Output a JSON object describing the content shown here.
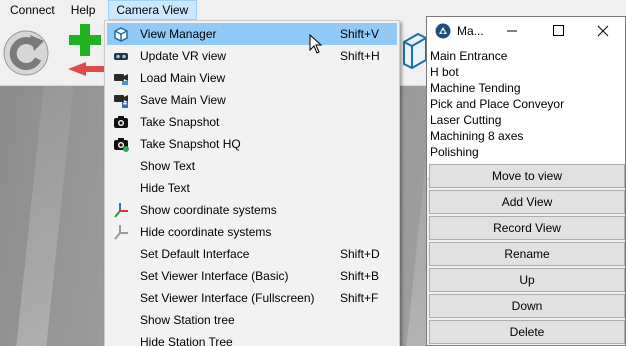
{
  "menubar": {
    "items": [
      {
        "label": "Connect"
      },
      {
        "label": "Help"
      },
      {
        "label": "Camera View"
      }
    ]
  },
  "camera_menu": {
    "items": [
      {
        "label": "View Manager",
        "shortcut": "Shift+V",
        "icon": "cube-outline-icon",
        "highlighted": true
      },
      {
        "label": "Update VR view",
        "shortcut": "Shift+H",
        "icon": "vr-goggles-icon"
      },
      {
        "label": "Load Main View",
        "shortcut": "",
        "icon": "load-camera-icon"
      },
      {
        "label": "Save Main View",
        "shortcut": "",
        "icon": "save-camera-icon"
      },
      {
        "label": "Take Snapshot",
        "shortcut": "",
        "icon": "camera-icon"
      },
      {
        "label": "Take Snapshot HQ",
        "shortcut": "",
        "icon": "camera-hq-icon"
      },
      {
        "label": "Show Text",
        "shortcut": "",
        "icon": ""
      },
      {
        "label": "Hide Text",
        "shortcut": "",
        "icon": ""
      },
      {
        "label": "Show coordinate systems",
        "shortcut": "",
        "icon": "axes-color-icon"
      },
      {
        "label": "Hide coordinate systems",
        "shortcut": "",
        "icon": "axes-gray-icon"
      },
      {
        "label": "Set Default Interface",
        "shortcut": "Shift+D",
        "icon": ""
      },
      {
        "label": "Set Viewer Interface (Basic)",
        "shortcut": "Shift+B",
        "icon": ""
      },
      {
        "label": "Set Viewer Interface (Fullscreen)",
        "shortcut": "Shift+F",
        "icon": ""
      },
      {
        "label": "Show Station tree",
        "shortcut": "",
        "icon": ""
      },
      {
        "label": "Hide Station Tree",
        "shortcut": "",
        "icon": ""
      }
    ]
  },
  "view_manager": {
    "title": "Ma...",
    "views": [
      "Main Entrance",
      "H bot",
      "Machine Tending",
      "Pick and Place Conveyor",
      "Laser Cutting",
      "Machining 8 axes",
      "Polishing"
    ],
    "buttons": [
      "Move to view",
      "Add View",
      "Record View",
      "Rename",
      "Up",
      "Down",
      "Delete"
    ]
  },
  "colors": {
    "menu_highlight": "#91c9f7",
    "menubar_active": "#cce8ff",
    "button_face": "#e1e1e1",
    "add_green": "#1fb11f",
    "window_icon_blue": "#1d4f7a"
  }
}
